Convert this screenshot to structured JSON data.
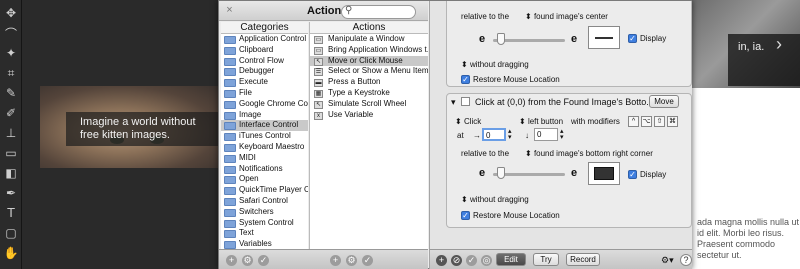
{
  "background": {
    "kitten_caption": "Imagine a world without free kitten images.",
    "right_dark_text": "in, ia.",
    "right_body_text": "ada magna mollis nulla ut id elit. Morbi leo risus. Praesent commodo sectetur ut."
  },
  "window": {
    "title": "Actions",
    "close_label": "×",
    "search_placeholder": "",
    "categories_header": "Categories",
    "actions_header": "Actions",
    "categories": [
      "Application Control",
      "Clipboard",
      "Control Flow",
      "Debugger",
      "Execute",
      "File",
      "Google Chrome Control",
      "Image",
      "Interface Control",
      "iTunes Control",
      "Keyboard Maestro",
      "MIDI",
      "Notifications",
      "Open",
      "QuickTime Player Co...",
      "Safari Control",
      "Switchers",
      "System Control",
      "Text",
      "Variables"
    ],
    "selected_category": "Interface Control",
    "actions": [
      "Manipulate a Window",
      "Bring Application Windows t...",
      "Move or Click Mouse",
      "Select or Show a Menu Item",
      "Press a Button",
      "Type a Keystroke",
      "Simulate Scroll Wheel",
      "Use Variable"
    ],
    "selected_action": "Move or Click Mouse"
  },
  "top_card": {
    "relative_label": "relative to the",
    "anchor_value": "found image's center",
    "e_left": "e",
    "e_right": "e",
    "display_label": "Display",
    "dragging_value": "without dragging",
    "restore_label": "Restore Mouse Location"
  },
  "main_card": {
    "title": "Click at (0,0) from the Found Image's Botto...",
    "move_label": "Move",
    "click_value": "Click",
    "button_value": "left button",
    "modifiers_label": "with modifiers",
    "modifier_keys": [
      "^",
      "⌥",
      "⇧",
      "⌘"
    ],
    "at_label": "at",
    "x_arrow": "→",
    "x_value": "0",
    "y_arrow": "↓",
    "y_value": "0",
    "relative_label": "relative to the",
    "anchor_value": "found image's bottom right corner",
    "e_left": "e",
    "e_right": "e",
    "display_label": "Display",
    "dragging_value": "without dragging",
    "restore_label": "Restore Mouse Location"
  },
  "bottom": {
    "edit_label": "Edit",
    "try_label": "Try",
    "record_label": "Record",
    "help_label": "?"
  }
}
